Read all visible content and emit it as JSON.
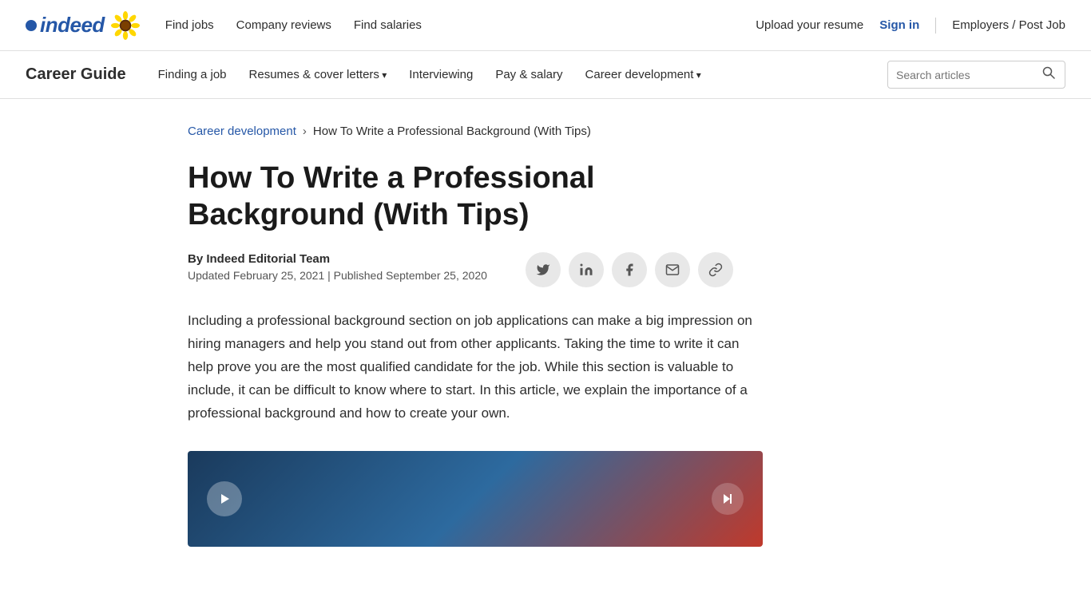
{
  "topNav": {
    "logoText": "indeed",
    "navLinks": [
      {
        "label": "Find jobs",
        "href": "#"
      },
      {
        "label": "Company reviews",
        "href": "#"
      },
      {
        "label": "Find salaries",
        "href": "#"
      }
    ],
    "rightLinks": [
      {
        "label": "Upload your resume",
        "href": "#"
      },
      {
        "label": "Sign in",
        "href": "#"
      },
      {
        "label": "Employers / Post Job",
        "href": "#"
      }
    ]
  },
  "careerNav": {
    "title": "Career Guide",
    "links": [
      {
        "label": "Finding a job",
        "href": "#",
        "dropdown": false
      },
      {
        "label": "Resumes & cover letters",
        "href": "#",
        "dropdown": true
      },
      {
        "label": "Interviewing",
        "href": "#",
        "dropdown": false
      },
      {
        "label": "Pay & salary",
        "href": "#",
        "dropdown": false
      },
      {
        "label": "Career development",
        "href": "#",
        "dropdown": true
      }
    ],
    "searchPlaceholder": "Search articles"
  },
  "breadcrumb": {
    "parent": "Career development",
    "separator": "›",
    "current": "How To Write a Professional Background (With Tips)"
  },
  "article": {
    "title": "How To Write a Professional Background (With Tips)",
    "authorLabel": "By Indeed Editorial Team",
    "dates": "Updated February 25, 2021  |  Published September 25, 2020",
    "intro": "Including a professional background section on job applications can make a big impression on hiring managers and help you stand out from other applicants. Taking the time to write it can help prove you are the most qualified candidate for the job. While this section is valuable to include, it can be difficult to know where to start. In this article, we explain the importance of a professional background and how to create your own.",
    "shareButtons": [
      {
        "name": "twitter",
        "icon": "🐦"
      },
      {
        "name": "linkedin",
        "icon": "in"
      },
      {
        "name": "facebook",
        "icon": "f"
      },
      {
        "name": "email",
        "icon": "✉"
      },
      {
        "name": "link",
        "icon": "🔗"
      }
    ]
  }
}
